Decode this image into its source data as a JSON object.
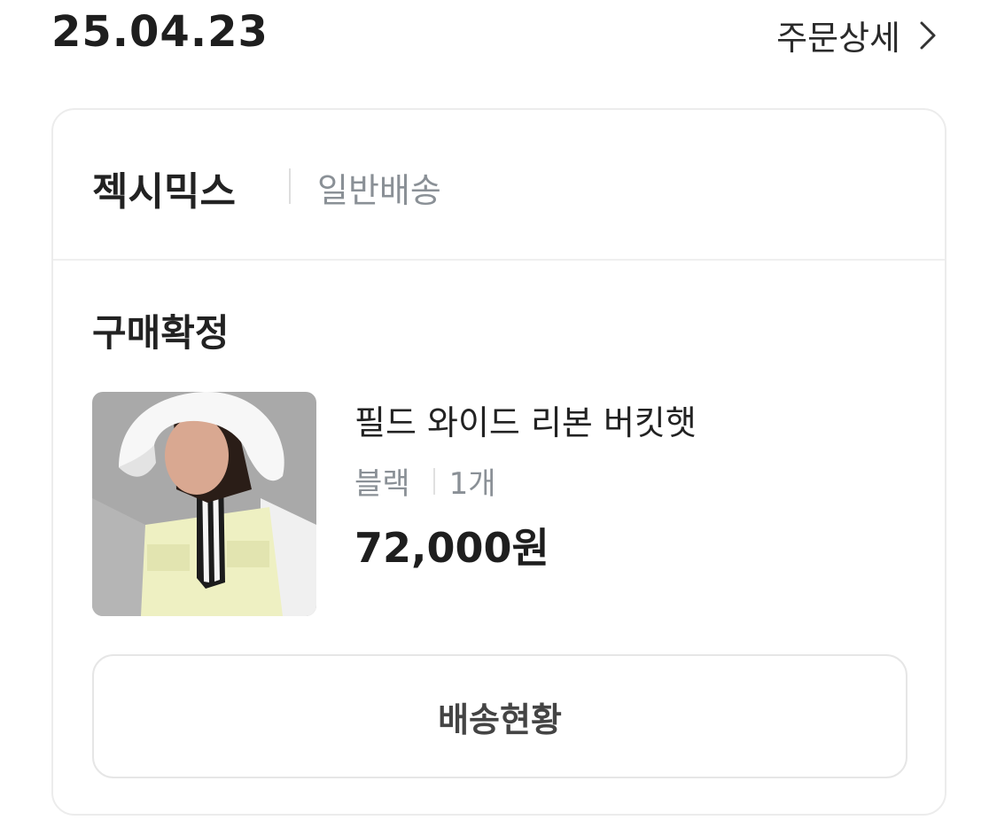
{
  "order": {
    "date": "25.04.23",
    "detail_link_label": "주문상세"
  },
  "seller": {
    "name": "젝시믹스",
    "shipping_type": "일반배송"
  },
  "status": "구매확정",
  "product": {
    "name": "필드 와이드 리본 버킷햇",
    "color": "블랙",
    "quantity": "1개",
    "price": "72,000원",
    "image_icon": "product-photo"
  },
  "actions": {
    "track_delivery_label": "배송현황"
  },
  "icons": {
    "detail_link": "chevron-right-icon"
  },
  "colors": {
    "text_primary": "#222222",
    "text_secondary": "#8a9096",
    "border": "#ececec"
  }
}
